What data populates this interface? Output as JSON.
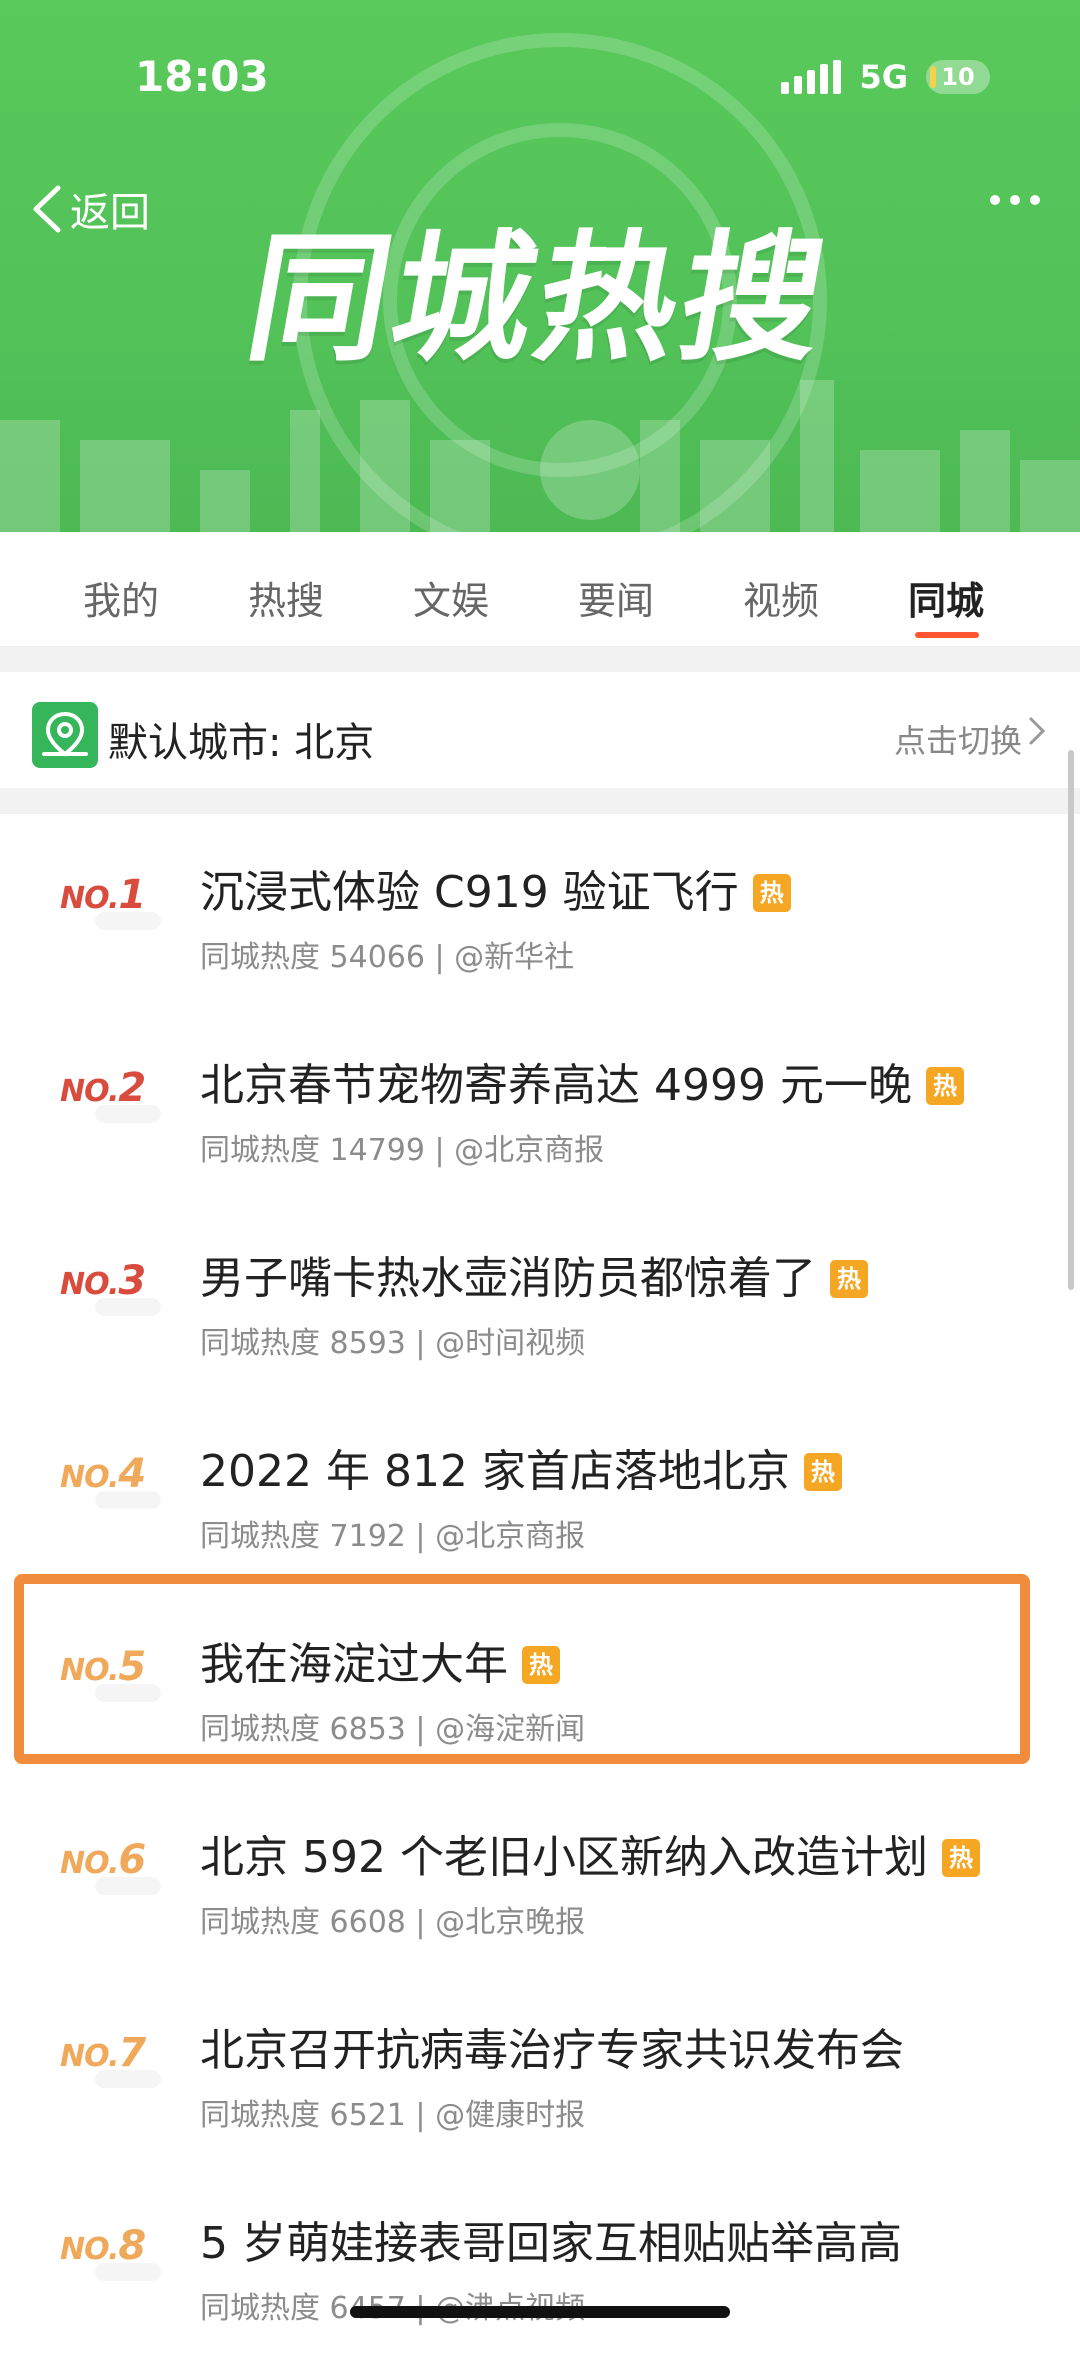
{
  "status_bar": {
    "time": "18:03",
    "network": "5G",
    "battery": "10"
  },
  "nav": {
    "back_label": "返回"
  },
  "banner": {
    "title": "同城热搜"
  },
  "tabs": [
    {
      "label": "我的",
      "active": false
    },
    {
      "label": "热搜",
      "active": false
    },
    {
      "label": "文娱",
      "active": false
    },
    {
      "label": "要闻",
      "active": false
    },
    {
      "label": "视频",
      "active": false
    },
    {
      "label": "同城",
      "active": true
    }
  ],
  "city": {
    "label": "默认城市: 北京",
    "switch_label": "点击切换"
  },
  "items": [
    {
      "rank_prefix": "NO.",
      "rank": "1",
      "title": "沉浸式体验 C919 验证飞行",
      "badge": "热",
      "meta": "同城热度 54066 | @新华社",
      "rank_color": "#d94b3d"
    },
    {
      "rank_prefix": "NO.",
      "rank": "2",
      "title": "北京春节宠物寄养高达 4999 元一晚",
      "badge": "热",
      "meta": "同城热度 14799 | @北京商报",
      "rank_color": "#d94b3d"
    },
    {
      "rank_prefix": "NO.",
      "rank": "3",
      "title": "男子嘴卡热水壶消防员都惊着了",
      "badge": "热",
      "meta": "同城热度 8593 | @时间视频",
      "rank_color": "#d94b3d"
    },
    {
      "rank_prefix": "NO.",
      "rank": "4",
      "title": "2022 年 812 家首店落地北京",
      "badge": "热",
      "meta": "同城热度 7192 | @北京商报",
      "rank_color": "#f0a85a"
    },
    {
      "rank_prefix": "NO.",
      "rank": "5",
      "title": "我在海淀过大年",
      "badge": "热",
      "meta": "同城热度 6853 | @海淀新闻",
      "rank_color": "#f0a85a"
    },
    {
      "rank_prefix": "NO.",
      "rank": "6",
      "title": "北京 592 个老旧小区新纳入改造计划",
      "badge": "热",
      "meta": "同城热度 6608 | @北京晚报",
      "rank_color": "#f0a85a"
    },
    {
      "rank_prefix": "NO.",
      "rank": "7",
      "title": "北京召开抗病毒治疗专家共识发布会",
      "badge": "",
      "meta": "同城热度 6521 | @健康时报",
      "rank_color": "#f0a85a"
    },
    {
      "rank_prefix": "NO.",
      "rank": "8",
      "title": "5 岁萌娃接表哥回家互相贴贴举高高",
      "badge": "",
      "meta": "同城热度 6457 | @沸点视频",
      "rank_color": "#f0a85a"
    }
  ],
  "colors": {
    "banner_green": "#55c55a",
    "tab_active_underline": "#ff5533",
    "hot_badge": "#f5a623",
    "highlight_border": "#f28c3d"
  }
}
